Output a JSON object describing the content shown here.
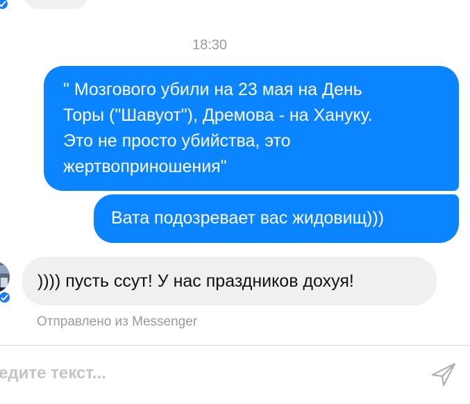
{
  "timestamp": "18:30",
  "messages": [
    {
      "direction": "outgoing",
      "lines": [
        "\" Мозгового убили на 23 мая на День",
        "Торы (\"Шавуот\"), Дремова - на Хануку.",
        "Это не просто убийства, это",
        "жертвоприношения\""
      ]
    },
    {
      "direction": "outgoing",
      "text": "Вата подозревает вас жидовищ)))"
    },
    {
      "direction": "incoming",
      "text": ")))) пусть ссут! У нас праздников дохуя!"
    }
  ],
  "sent_via": "Отправлено из Messenger",
  "composer": {
    "placeholder": "едите текст..."
  },
  "icons": {
    "send": "send-icon",
    "verified_badge": "messenger-badge-icon"
  },
  "colors": {
    "outgoing_bubble": "#0a84ff",
    "incoming_bubble": "#f1f0f0",
    "muted_text": "#9a9a9a",
    "placeholder": "#c4c4c4"
  }
}
